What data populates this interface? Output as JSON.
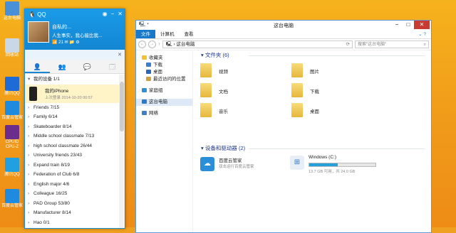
{
  "desktop": {
    "icons": [
      {
        "label": "这台电脑"
      },
      {
        "label": "回收站"
      },
      {
        "label": "腾讯QQ"
      },
      {
        "label": "百度云管家"
      },
      {
        "label": "CPUID CPU-Z"
      },
      {
        "label": "腾讯QQ"
      },
      {
        "label": "百度云管家"
      }
    ]
  },
  "qq": {
    "title": "QQ",
    "nickname": "自私的...",
    "signature": "人生事实，我心能比我...",
    "status_icons": "📶 21 ✉ 📁 ⚙",
    "search_placeholder": "",
    "tabs": [
      "👤",
      "👥",
      "💬",
      "🗔"
    ],
    "my_devices": "我的设备 1/1",
    "device_name": "我的iPhone",
    "device_status": "上次登录 2014-10-20 00:57",
    "groups": [
      {
        "name": "Friends",
        "count": "7/15"
      },
      {
        "name": "Family",
        "count": "6/14"
      },
      {
        "name": "Skateboarder",
        "count": "8/14"
      },
      {
        "name": "Middle school classmate",
        "count": "7/13"
      },
      {
        "name": "high school classmate",
        "count": "26/44"
      },
      {
        "name": "University friends",
        "count": "23/43"
      },
      {
        "name": "Expand train",
        "count": "8/19"
      },
      {
        "name": "Federation of Club",
        "count": "6/8"
      },
      {
        "name": "English major",
        "count": "4/6"
      },
      {
        "name": "Colleague",
        "count": "16/25"
      },
      {
        "name": "PAD Group",
        "count": "53/80"
      },
      {
        "name": "Manufacturer",
        "count": "8/14"
      },
      {
        "name": "Hao",
        "count": "0/1"
      }
    ]
  },
  "explorer": {
    "title": "这台电脑",
    "ribbon": {
      "file": "文件",
      "computer": "计算机",
      "view": "查看"
    },
    "path": "这台电脑",
    "search_placeholder": "搜索\"这台电脑\"",
    "nav": [
      {
        "label": "收藏夹",
        "sub": false,
        "color": "#f2c230"
      },
      {
        "label": "下载",
        "sub": true,
        "color": "#3a7ed0"
      },
      {
        "label": "桌面",
        "sub": true,
        "color": "#2d66b8"
      },
      {
        "label": "最近访问的位置",
        "sub": true,
        "color": "#d0a040"
      },
      {
        "label": "家庭组",
        "sub": false,
        "color": "#2e8fd4"
      },
      {
        "label": "这台电脑",
        "sub": false,
        "color": "#2a78c8"
      },
      {
        "label": "网络",
        "sub": false,
        "color": "#3f7fc4"
      }
    ],
    "folders_header": "文件夹 (6)",
    "folders": [
      "视频",
      "图片",
      "文档",
      "下载",
      "音乐",
      "桌面"
    ],
    "devices_header": "设备和驱动器 (2)",
    "drives": [
      {
        "name": "百度云管家",
        "detail": "双击运行百度云管家"
      },
      {
        "name": "Windows (C:)",
        "detail": "13.7 GB 可用，共 24.0 GB",
        "used_fraction": 0.43
      }
    ]
  }
}
